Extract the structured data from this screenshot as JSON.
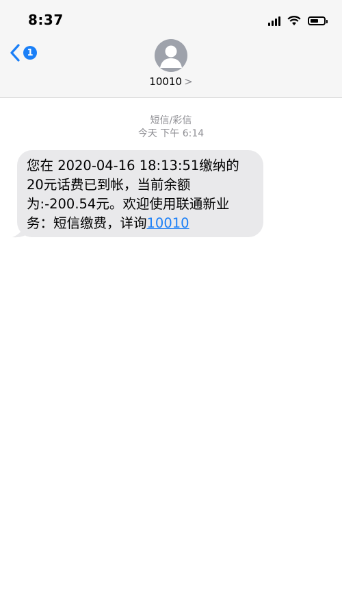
{
  "status_bar": {
    "time": "8:37"
  },
  "nav": {
    "back_badge": "1",
    "contact_name": "10010",
    "contact_chevron": ">"
  },
  "conversation": {
    "message_type": "短信/彩信",
    "timestamp": "今天 下午 6:14",
    "messages": [
      {
        "direction": "incoming",
        "text": "您在 2020-04-16 18:13:51缴纳的20元话费已到帐，当前余额为:-200.54元。欢迎使用联通新业务：短信缴费，详询",
        "link_text": "10010"
      }
    ]
  },
  "colors": {
    "accent": "#1a7ff7",
    "bubble": "#e9e9eb",
    "header_bg": "#f6f6f6",
    "meta_text": "#8e8e93"
  },
  "icons": [
    "signal-icon",
    "wifi-icon",
    "battery-icon",
    "back-chevron-icon",
    "contact-avatar-icon",
    "chevron-right-icon"
  ]
}
